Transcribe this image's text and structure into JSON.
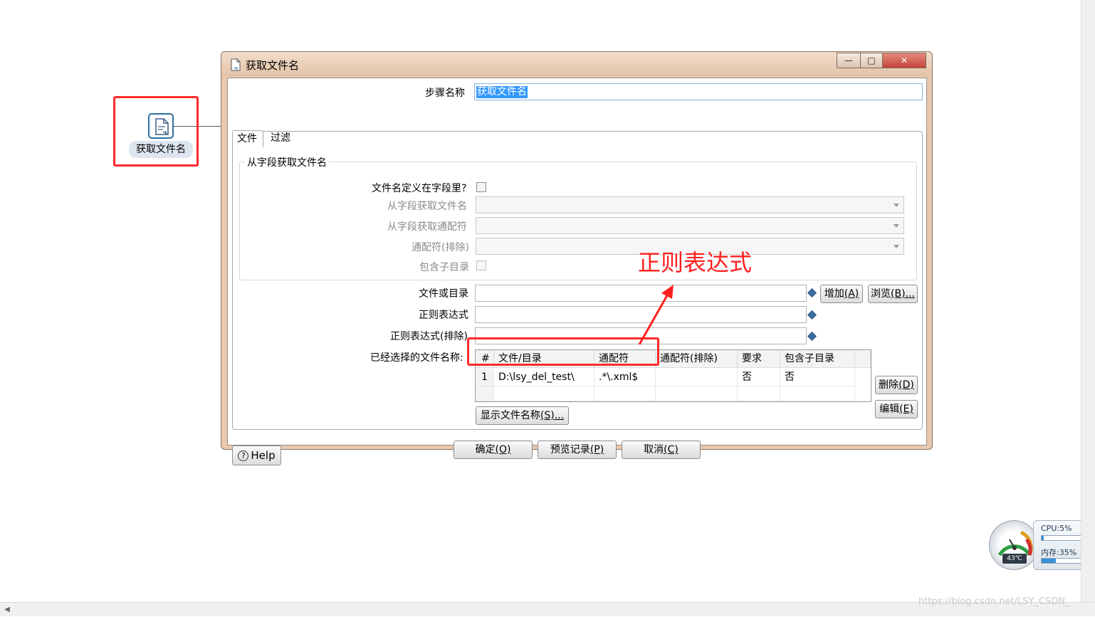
{
  "canvas": {
    "step_label": "获取文件名",
    "annotation": "正则表达式"
  },
  "dialog": {
    "title": "获取文件名",
    "window_buttons": {
      "minimize": "—",
      "maximize": "□",
      "close": "✕"
    },
    "step_name_label": "步骤名称",
    "step_name_value": "获取文件名",
    "tabs": [
      "文件",
      "过滤"
    ],
    "group_title": "从字段获取文件名",
    "fields_from_field": {
      "defined_in_field_label": "文件名定义在字段里?",
      "filename_from_field_label": "从字段获取文件名",
      "wildcard_from_field_label": "从字段获取通配符",
      "exclude_wildcard_label": "通配符(排除)",
      "include_subdirs_label": "包含子目录"
    },
    "file_or_dir_label": "文件或目录",
    "regex_label": "正则表达式",
    "regex_exclude_label": "正则表达式(排除)",
    "selected_files_label": "已经选择的文件名称:",
    "add_button": "增加",
    "add_hotkey": "(A)",
    "browse_button": "浏览",
    "browse_hotkey": "(B)...",
    "delete_button": "删除",
    "delete_hotkey": "(D)",
    "edit_button": "编辑",
    "edit_hotkey": "(E)",
    "show_files_button": "显示文件名称",
    "show_files_hotkey": "(S)...",
    "table": {
      "headers": [
        "#",
        "文件/目录",
        "通配符",
        "通配符(排除)",
        "要求",
        "包含子目录"
      ],
      "rows": [
        {
          "num": "1",
          "path": "D:\\lsy_del_test\\",
          "wildcard": ".*\\.xml$",
          "exclude": "",
          "required": "否",
          "subdirs": "否"
        }
      ]
    },
    "footer": {
      "help": "Help",
      "ok": "确定",
      "ok_hotkey": "(O)",
      "preview": "预览记录",
      "preview_hotkey": "(P)",
      "cancel": "取消",
      "cancel_hotkey": "(C)"
    }
  },
  "monitor": {
    "cpu": "CPU:5%",
    "cpu_fraction": 0.05,
    "memory": "内存:35%",
    "memory_fraction": 0.35,
    "temperature": "43℃"
  },
  "watermark": "https://blog.csdn.net/LSY_CSDN_"
}
